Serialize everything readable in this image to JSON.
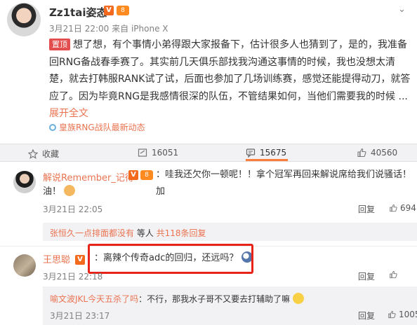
{
  "post": {
    "author": "Zz1tai姿态",
    "verified_icon": "V",
    "level_icon": "8",
    "time": "3月21日 22:00",
    "device": "来自 iPhone X",
    "pinned_tag": "置顶",
    "text": "想了想，有个事情小弟得跟大家报备下，估计很多人也猜到了，是的，我准备回RNG备战春季赛了。其实前几天俱乐部找我沟通这事情的时候，我也没想太清楚，就去打韩服RANK试了试，后面也参加了几场训练赛，感觉还能提得动刀，就答应了。因为毕竟RNG是我感情很深的队伍，不管结果如何，当他们需要我的时候 ...",
    "expand": "展开全文",
    "topic": "皇族RNG战队最新动态"
  },
  "actions": {
    "favorite": "收藏",
    "repost": "16051",
    "comment": "15675",
    "like": "40560"
  },
  "comments": [
    {
      "name": "解说Remember_记得",
      "text": "：哇我还欠你一顿呢！！拿个冠军再回来解说席给我们说骚话！加",
      "text2": "油！",
      "time": "3月21日 22:05",
      "reply": "回复",
      "likes": "694",
      "sub": {
        "names": "张恒久一点排面都没有",
        "rest": " 等人 ",
        "count": "共118条回复"
      }
    },
    {
      "name": "王思聪",
      "text": "：离辣个传奇adc的回归，还远吗？",
      "time": "3月21日 22:18",
      "reply": "回复",
      "likes": "",
      "sub": {
        "name": "喻文波JKL今天五杀了吗",
        "text": "：不行，那我水子哥不又要去打辅助了嘛",
        "time": "3月21日 23:17",
        "reply": "回复",
        "likes": "1005"
      }
    }
  ],
  "colors": {
    "accent": "#eb7350",
    "highlight": "#e8231a",
    "tag": "#e34d4d"
  }
}
